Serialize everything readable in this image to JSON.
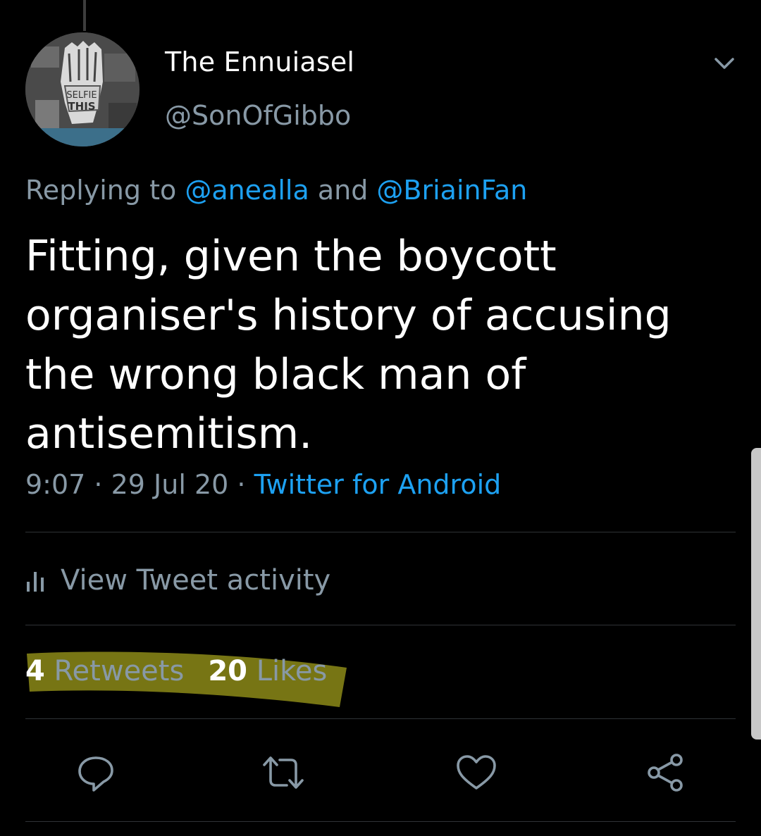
{
  "author": {
    "display_name": "The Ennuiasel",
    "handle": "@SonOfGibbo",
    "avatar_icon": "fist-poster-avatar",
    "avatar_text_1": "SELFIE",
    "avatar_text_2": "THIS"
  },
  "reply": {
    "prefix": "Replying to ",
    "mention_1": "@anealla",
    "joiner": " and ",
    "mention_2": "@BriainFan"
  },
  "tweet": {
    "lines": [
      "Fitting, given the boycott",
      "organiser's history of accusing",
      "the wrong black man of",
      "antisemitism."
    ],
    "time": "9:07",
    "sep_1": " · ",
    "date": "29 Jul 20",
    "sep_2": " · ",
    "source": "Twitter for Android"
  },
  "activity": {
    "icon": "bar-chart-icon",
    "label": "View Tweet activity"
  },
  "stats": {
    "retweets_count": "4",
    "retweets_label": " Retweets",
    "likes_count": "20",
    "likes_label": " Likes"
  },
  "actions": {
    "reply_icon": "reply-icon",
    "retweet_icon": "retweet-icon",
    "like_icon": "heart-icon",
    "share_icon": "share-icon"
  },
  "colors": {
    "background": "#000000",
    "text_primary": "#ffffff",
    "text_secondary": "#8899a6",
    "link": "#1da1f2",
    "highlight": "#8c8a18"
  }
}
